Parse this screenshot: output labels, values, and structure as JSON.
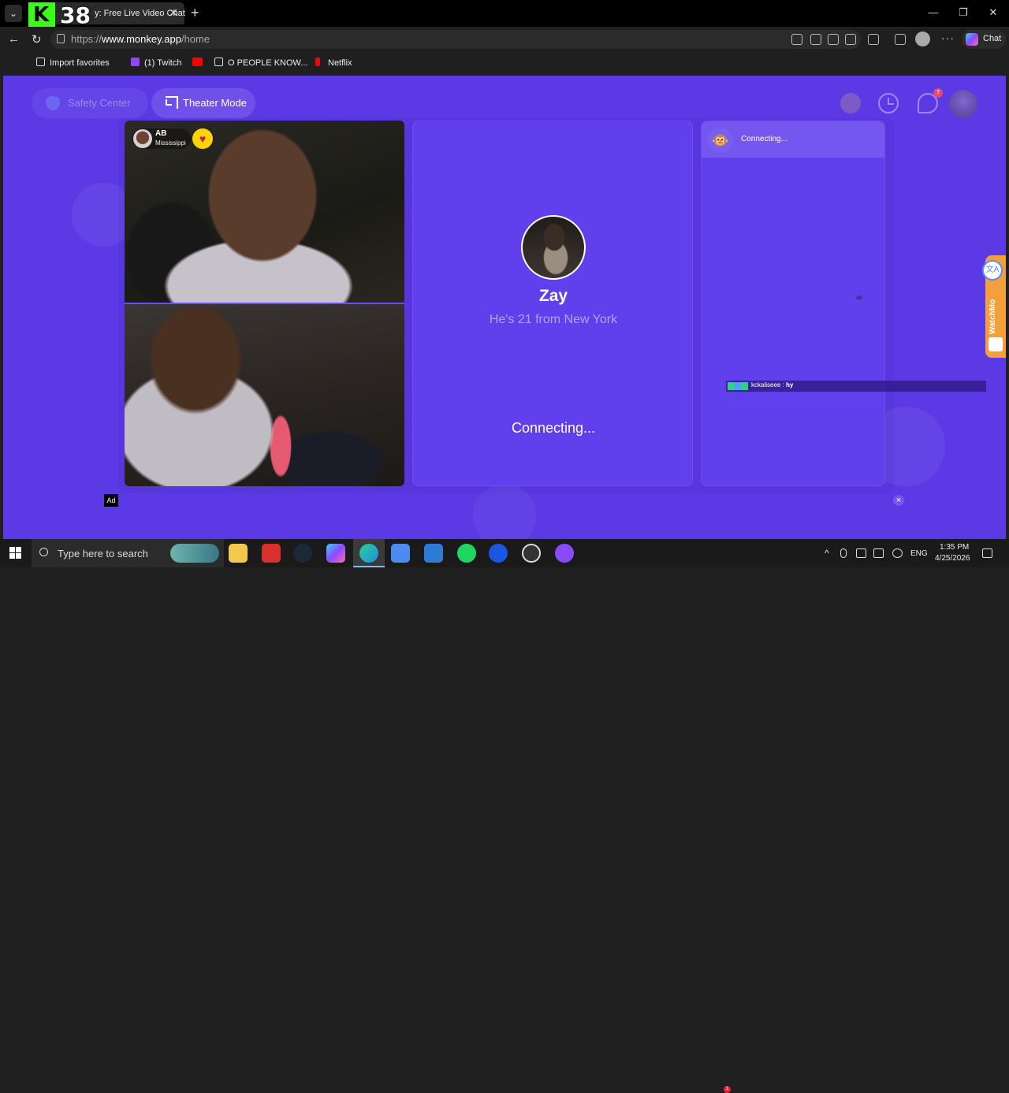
{
  "browser": {
    "tab_title": "y: Free Live Video Chat",
    "overlay_badge": "38",
    "url_prefix": "https://",
    "url_host": "www.monkey.app",
    "url_path": "/home",
    "chat_label": "Chat",
    "bookmarks": [
      {
        "label": "Import favorites",
        "color": "#dddddd"
      },
      {
        "label": "(1) Twitch",
        "color": "#9146ff"
      },
      {
        "label": "",
        "color": "#ff0000"
      },
      {
        "label": "O PEOPLE KNOW...",
        "color": "#dddddd"
      },
      {
        "label": "Netflix",
        "color": "#e50914"
      }
    ]
  },
  "header": {
    "safety_center": "Safety Center",
    "theater_mode": "Theater Mode",
    "messages_badge": "7"
  },
  "video_local": {
    "name": "AB",
    "location": "Mississippi"
  },
  "match": {
    "name": "Zay",
    "info": "He's 21 from New York",
    "status": "Connecting..."
  },
  "chat": {
    "status": "Connecting...",
    "overlay_user": "kckaliseee",
    "overlay_message": "hy"
  },
  "watch_widget": {
    "label": "WatchMo"
  },
  "ad": {
    "label": "Ad",
    "close": "×"
  },
  "taskbar": {
    "search_placeholder": "Type here to search",
    "notif_badge": "1",
    "language": "ENG",
    "time": "1:35 PM",
    "date": "4/25/2026"
  },
  "colors": {
    "page_bg": "#5b3ae6",
    "panel_bg": "#6040ec",
    "heart": "#ffd400",
    "watch_widget": "#f3a03c"
  }
}
